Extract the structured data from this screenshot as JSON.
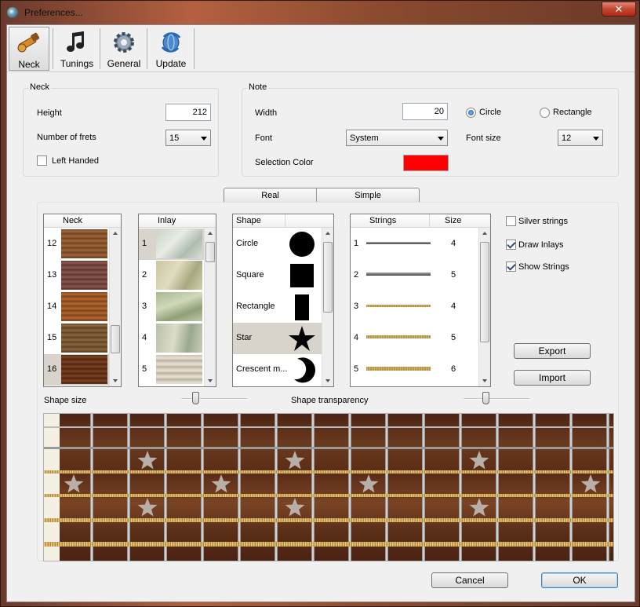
{
  "window": {
    "title": "Preferences...",
    "close_glyph": "✕"
  },
  "toolbar": {
    "items": [
      {
        "label": "Neck",
        "icon": "guitar-neck-icon"
      },
      {
        "label": "Tunings",
        "icon": "music-notes-icon"
      },
      {
        "label": "General",
        "icon": "gear-icon"
      },
      {
        "label": "Update",
        "icon": "globe-refresh-icon"
      }
    ]
  },
  "neck": {
    "group_label": "Neck",
    "height_label": "Height",
    "height_value": "212",
    "frets_label": "Number of frets",
    "frets_value": "15",
    "left_handed_label": "Left Handed",
    "left_handed_checked": false
  },
  "note": {
    "group_label": "Note",
    "width_label": "Width",
    "width_value": "20",
    "font_label": "Font",
    "font_value": "System",
    "selection_color_label": "Selection Color",
    "selection_color": "#ff0000",
    "circle_label": "Circle",
    "rectangle_label": "Rectangle",
    "shape_selected": "Circle",
    "font_size_label": "Font size",
    "font_size_value": "12"
  },
  "view_toggle": {
    "real": "Real",
    "simple": "Simple"
  },
  "lists": {
    "neck": {
      "header": "Neck",
      "rows": [
        "12",
        "13",
        "14",
        "15",
        "16"
      ],
      "selected": "16"
    },
    "inlay": {
      "header": "Inlay",
      "rows": [
        "1",
        "2",
        "3",
        "4",
        "5"
      ],
      "selected": "1"
    },
    "shape": {
      "header": "Shape",
      "rows": [
        "Circle",
        "Square",
        "Rectangle",
        "Star",
        "Crescent m..."
      ],
      "selected": "Star"
    },
    "strings": {
      "header_strings": "Strings",
      "header_size": "Size",
      "rows": [
        {
          "num": "1",
          "size": "4"
        },
        {
          "num": "2",
          "size": "5"
        },
        {
          "num": "3",
          "size": "4"
        },
        {
          "num": "4",
          "size": "5"
        },
        {
          "num": "5",
          "size": "6"
        }
      ]
    }
  },
  "options": {
    "silver_strings": {
      "label": "Silver strings",
      "checked": false
    },
    "draw_inlays": {
      "label": "Draw Inlays",
      "checked": true
    },
    "show_strings": {
      "label": "Show Strings",
      "checked": true
    }
  },
  "buttons": {
    "export": "Export",
    "import": "Import",
    "cancel": "Cancel",
    "ok": "OK"
  },
  "sliders": {
    "shape_size_label": "Shape size",
    "shape_transparency_label": "Shape transparency"
  }
}
